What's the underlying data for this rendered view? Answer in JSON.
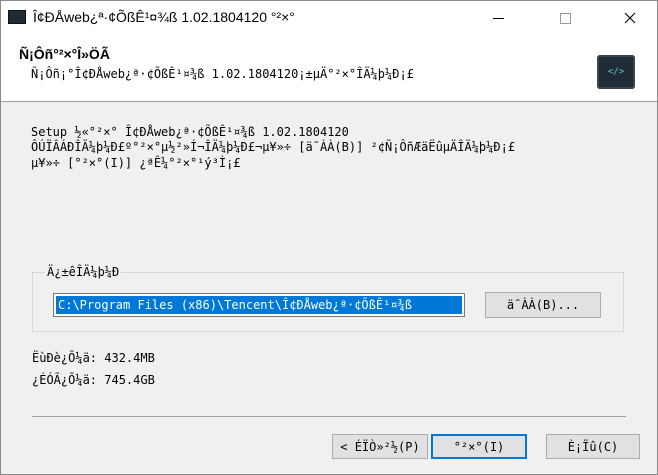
{
  "window": {
    "title": "Î¢ÐÅweb¿ª·¢ÕßÊ¹¤¾ß 1.02.1804120 °²×°"
  },
  "header": {
    "title": "Ñ¡Ôñ°²×°Î»ÖÃ",
    "subtitle": "Ñ¡Ôñ¡°Î¢ÐÅweb¿ª·¢ÕßÊ¹¤¾ß 1.02.1804120¡±µÄ°²×°ÎÄ¼þ¼Ð¡£"
  },
  "body": {
    "line1": "Setup ½«°²×° Î¢ÐÅweb¿ª·¢ÕßÊ¹¤¾ß 1.02.1804120",
    "line2": "ÔÚÏÂÁÐÎÄ¼þ¼Ð£º°²×°µ½²»Í¬ÎÄ¼þ¼Ð£¬µ¥»÷ [ä¯ÀÀ(B)] ²¢Ñ¡ÔñÆäËûµÄÎÄ¼þ¼Ð¡£",
    "line3": "µ¥»÷ [°²×°(I)] ¿ªÊ¼°²×°¹ý³Ì¡£"
  },
  "target_group": {
    "label": "Ä¿±êÎÄ¼þ¼Ð",
    "path_value": "C:\\Program Files (x86)\\Tencent\\Î¢ÐÅweb¿ª·¢ÕßÊ¹¤¾ß",
    "browse_label": "ä¯ÀÀ(B)..."
  },
  "space": {
    "required": "ËùÐè¿Õ¼ä: 432.4MB",
    "available": "¿ÉÓÃ¿Õ¼ä: 745.4GB"
  },
  "buttons": {
    "back": "< ÉÏÒ»²½(P)",
    "install": "°²×°(I)",
    "cancel": "È¡Ïû(C)"
  },
  "icons": {
    "app": "wechat-devtools-icon",
    "header": "code-brackets-icon",
    "close": "×"
  }
}
